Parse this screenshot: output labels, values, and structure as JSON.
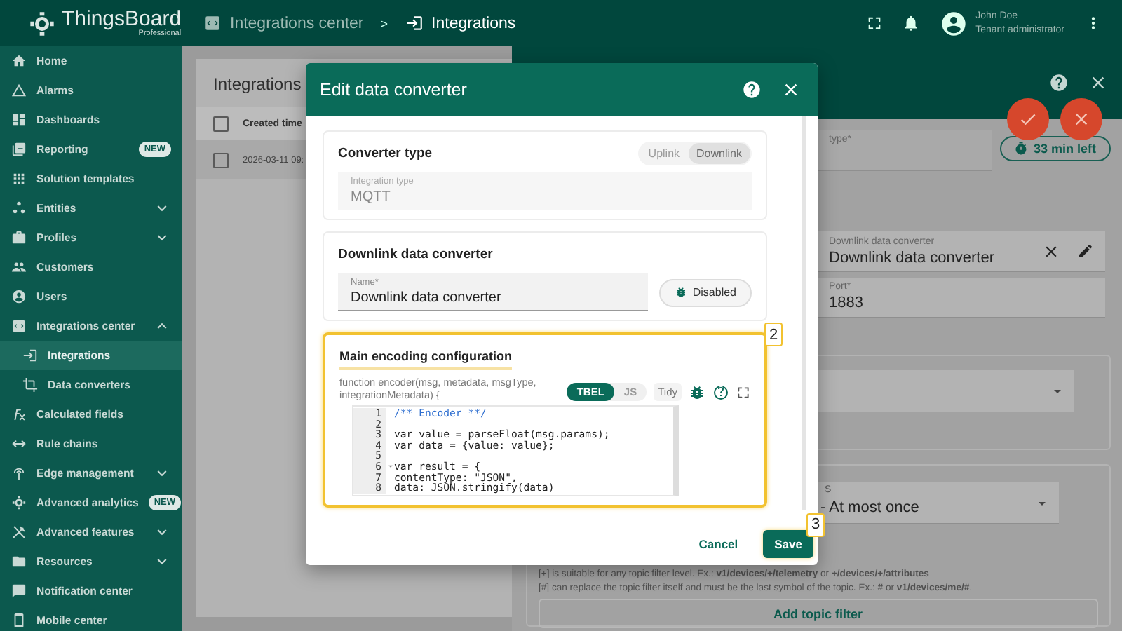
{
  "header": {
    "logo": {
      "title": "ThingsBoard",
      "subtitle": "Professional"
    },
    "breadcrumbs": [
      {
        "label": "Integrations center",
        "current": false
      },
      {
        "label": "Integrations",
        "current": true
      }
    ],
    "separator": ">",
    "user": {
      "name": "John Doe",
      "role": "Tenant administrator"
    }
  },
  "sidebar": {
    "items": [
      {
        "label": "Home",
        "selected": false
      },
      {
        "label": "Alarms",
        "selected": false
      },
      {
        "label": "Dashboards",
        "selected": false
      },
      {
        "label": "Reporting",
        "selected": false,
        "badge": "NEW"
      },
      {
        "label": "Solution templates",
        "selected": false
      },
      {
        "label": "Entities",
        "selected": false,
        "expanded": false
      },
      {
        "label": "Profiles",
        "selected": false,
        "expanded": false
      },
      {
        "label": "Customers",
        "selected": false
      },
      {
        "label": "Users",
        "selected": false
      },
      {
        "label": "Integrations center",
        "selected": false,
        "expanded": true,
        "children": [
          {
            "label": "Integrations",
            "selected": true
          },
          {
            "label": "Data converters",
            "selected": false
          }
        ]
      },
      {
        "label": "Calculated fields",
        "selected": false
      },
      {
        "label": "Rule chains",
        "selected": false
      },
      {
        "label": "Edge management",
        "selected": false,
        "expanded": false
      },
      {
        "label": "Advanced analytics",
        "selected": false,
        "badge": "NEW"
      },
      {
        "label": "Advanced features",
        "selected": false,
        "expanded": false
      },
      {
        "label": "Resources",
        "selected": false,
        "expanded": false
      },
      {
        "label": "Notification center",
        "selected": false
      },
      {
        "label": "Mobile center",
        "selected": false
      }
    ]
  },
  "integrations_list": {
    "title": "Integrations",
    "all_checked": false,
    "columns": [
      "Created time"
    ],
    "rows": [
      {
        "checked": false,
        "cells": [
          "2026-03-11 09:"
        ]
      }
    ]
  },
  "drawer": {
    "integration_type": {
      "label": "type*"
    },
    "timer": "33 min left",
    "downlink_converter": {
      "label": "Downlink data converter",
      "value": "Downlink data converter"
    },
    "port": {
      "label": "Port*",
      "value": "1883"
    },
    "qos": {
      "label": "S",
      "value": "- At most once"
    },
    "help_lines": [
      "[+] is suitable for any topic filter level. Ex.: **v1/devices/+/telemetry** or **+/devices/+/attributes**",
      "[#] can replace the topic filter itself and must be the last symbol of the topic. Ex.: **#** or **v1/devices/me/#**."
    ],
    "add_button": "Add topic filter"
  },
  "dialog": {
    "title": "Edit data converter",
    "converter_type": {
      "title": "Converter type",
      "options": [
        {
          "label": "Uplink",
          "selected": false
        },
        {
          "label": "Downlink",
          "selected": true
        }
      ],
      "field": {
        "label": "Integration type",
        "value": "MQTT",
        "disabled": true
      }
    },
    "downlink": {
      "title": "Downlink data converter",
      "name_field": {
        "label": "Name*",
        "value": "Downlink data converter"
      },
      "debug_button": "Disabled"
    },
    "encoding": {
      "title": "Main encoding configuration",
      "highlighted": true,
      "step": "2",
      "signature": "function encoder(msg, metadata, msgType, integrationMetadata) {",
      "languages": [
        {
          "label": "TBEL",
          "selected": true
        },
        {
          "label": "JS",
          "selected": false
        }
      ],
      "tidy": "Tidy",
      "code": [
        {
          "number": "1",
          "kind": "comment",
          "text": "/** Encoder **/"
        },
        {
          "number": "2",
          "kind": "code"
        },
        {
          "number": "3",
          "kind": "code",
          "text": "var value = parseFloat(msg.params);"
        },
        {
          "number": "4",
          "kind": "code",
          "text": "var data = {value: value};"
        },
        {
          "number": "5",
          "kind": "code"
        },
        {
          "number": "6",
          "kind": "code",
          "text": "var result = {",
          "foldable": true
        },
        {
          "number": "7",
          "kind": "code",
          "text": "contentType: \"JSON\","
        },
        {
          "number": "8",
          "kind": "code",
          "text": "data: JSON.stringify(data)"
        }
      ]
    },
    "buttons": [
      {
        "label": "Cancel",
        "kind": "text"
      },
      {
        "label": "Save",
        "kind": "primary",
        "highlighted": true,
        "step": "3"
      }
    ]
  }
}
